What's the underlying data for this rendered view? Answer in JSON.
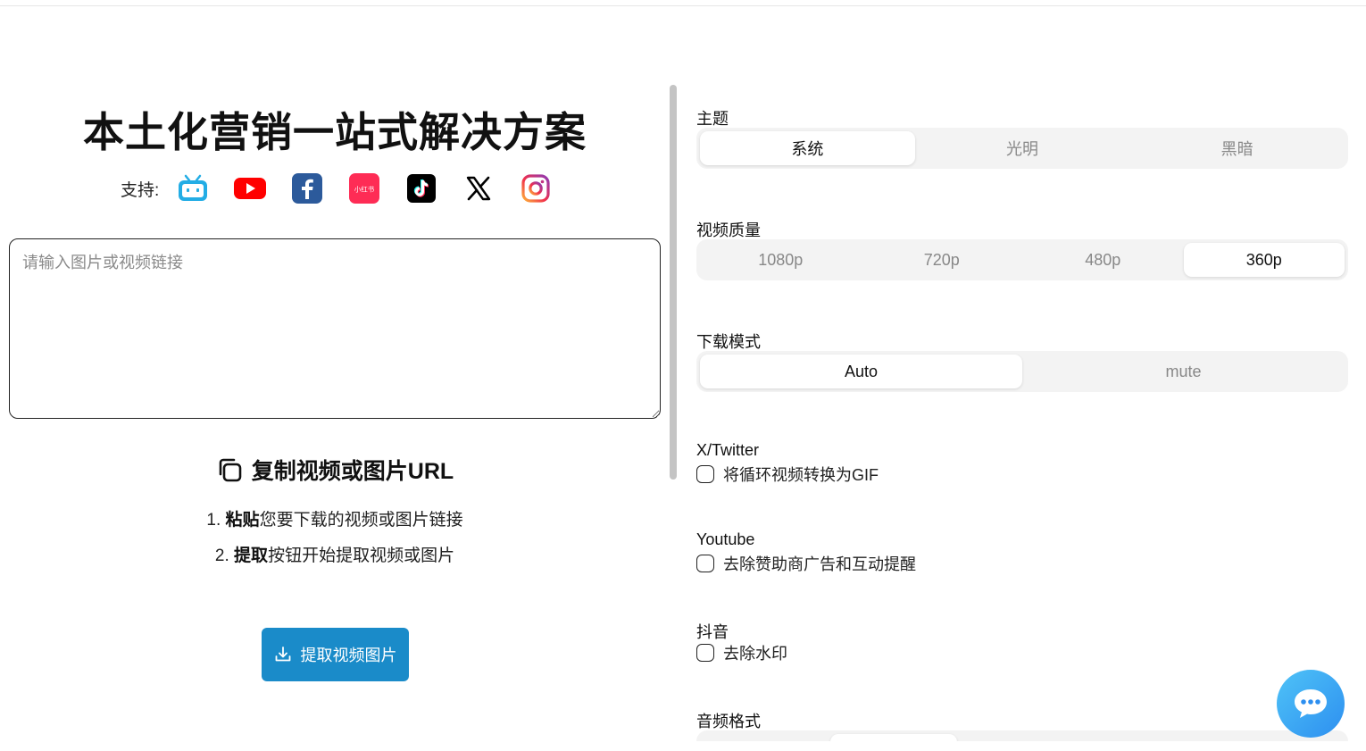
{
  "hero": {
    "title": "本土化营销一站式解决方案",
    "support_label": "支持:",
    "platforms": [
      "bilibili-icon",
      "youtube-icon",
      "facebook-icon",
      "xiaohongshu-icon",
      "tiktok-icon",
      "x-icon",
      "instagram-icon"
    ],
    "xiaohongshu_text": "小红书"
  },
  "input": {
    "placeholder": "请输入图片或视频链接",
    "value": ""
  },
  "instructions": {
    "heading": "复制视频或图片URL",
    "step1_num": "1.",
    "step1_bold": "粘贴",
    "step1_rest": "您要下载的视频或图片链接",
    "step2_num": "2.",
    "step2_bold": "提取",
    "step2_rest": "按钮开始提取视频或图片"
  },
  "extract_button": {
    "label": "提取视频图片",
    "color": "#1a8bc9"
  },
  "settings": {
    "theme": {
      "label": "主题",
      "options": [
        "系统",
        "光明",
        "黑暗"
      ],
      "selected": "系统"
    },
    "quality": {
      "label": "视频质量",
      "options": [
        "1080p",
        "720p",
        "480p",
        "360p"
      ],
      "selected": "360p"
    },
    "download_mode": {
      "label": "下载模式",
      "options": [
        "Auto",
        "mute"
      ],
      "selected": "Auto"
    },
    "twitter": {
      "label": "X/Twitter",
      "checkbox_label": "将循环视频转换为GIF",
      "checked": false
    },
    "youtube": {
      "label": "Youtube",
      "checkbox_label": "去除赞助商广告和互动提醒",
      "checked": false
    },
    "douyin": {
      "label": "抖音",
      "checkbox_label": "去除水印",
      "checked": false
    },
    "audio_format": {
      "label": "音频格式"
    }
  },
  "chat": {
    "icon": "chat-bubble-icon"
  }
}
